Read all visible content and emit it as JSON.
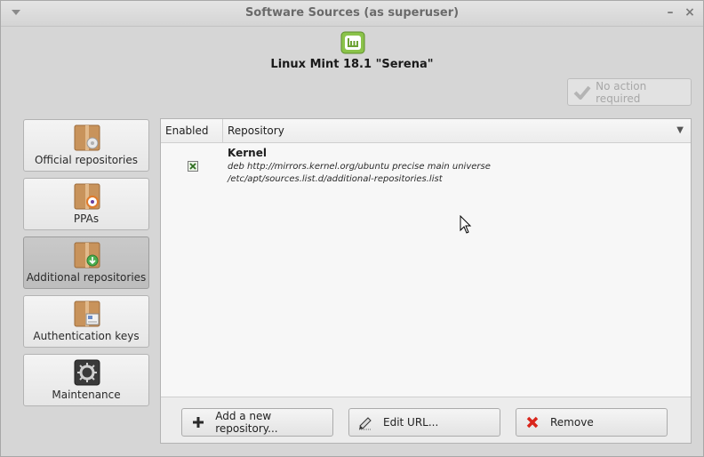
{
  "window": {
    "title": "Software Sources (as superuser)",
    "menu_icon": "chevron-down-icon",
    "minimize_glyph": "–",
    "close_glyph": "×"
  },
  "header": {
    "distro": "Linux Mint 18.1 \"Serena\"",
    "logo_icon": "linux-mint-logo-icon"
  },
  "status_button": {
    "label": "No action required",
    "icon": "checkmark-icon",
    "enabled": false
  },
  "sidebar": {
    "items": [
      {
        "label": "Official repositories",
        "icon": "package-box-icon",
        "active": false
      },
      {
        "label": "PPAs",
        "icon": "package-ppa-icon",
        "active": false
      },
      {
        "label": "Additional repositories",
        "icon": "package-add-icon",
        "active": true
      },
      {
        "label": "Authentication keys",
        "icon": "package-key-icon",
        "active": false
      },
      {
        "label": "Maintenance",
        "icon": "maintenance-icon",
        "active": false
      }
    ]
  },
  "repo_list": {
    "columns": [
      "Enabled",
      "Repository"
    ],
    "sort_glyph": "▼",
    "rows": [
      {
        "enabled": true,
        "name": "Kernel",
        "line1": "deb http://mirrors.kernel.org/ubuntu precise main universe",
        "line2": "/etc/apt/sources.list.d/additional-repositories.list"
      }
    ]
  },
  "buttons": {
    "add": "Add a new repository...",
    "edit": "Edit URL...",
    "remove": "Remove"
  },
  "colors": {
    "mint_green": "#8bc34a",
    "remove_red": "#d9261c",
    "box_brown": "#c8935b"
  }
}
